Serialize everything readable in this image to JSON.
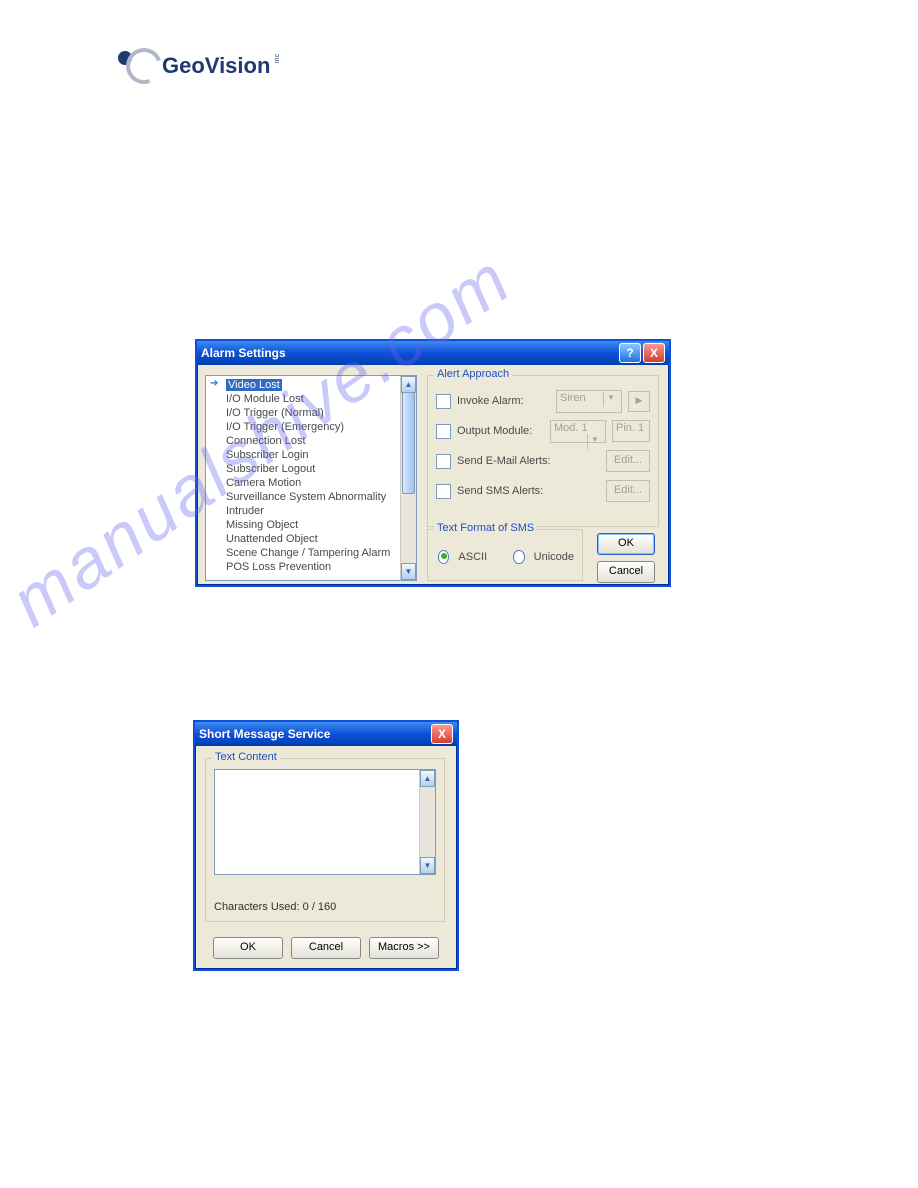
{
  "logo": {
    "geo": "Geo",
    "vision": "Vision",
    "inc": "inc"
  },
  "watermark": "manualshive.com",
  "alarm": {
    "title": "Alarm Settings",
    "help": "?",
    "close": "X",
    "list": [
      "Video Lost",
      "I/O Module Lost",
      "I/O Trigger (Normal)",
      "I/O Trigger (Emergency)",
      "Connection Lost",
      "Subscriber Login",
      "Subscriber Logout",
      "Camera Motion",
      "Surveillance System Abnormality",
      "Intruder",
      "Missing Object",
      "Unattended Object",
      "Scene Change / Tampering Alarm",
      "POS Loss Prevention"
    ],
    "group1": {
      "title": "Alert Approach",
      "invoke": "Invoke Alarm:",
      "siren": "Siren",
      "output": "Output Module:",
      "mod": "Mod. 1",
      "pin": "Pin. 1",
      "email": "Send E-Mail Alerts:",
      "edit": "Edit...",
      "sms": "Send SMS Alerts:"
    },
    "group2": {
      "title": "Text Format of SMS",
      "ascii": "ASCII",
      "unicode": "Unicode"
    },
    "ok": "OK",
    "cancel": "Cancel"
  },
  "sms": {
    "title": "Short Message Service",
    "close": "X",
    "group": "Text Content",
    "chars": "Characters Used:  0 / 160",
    "ok": "OK",
    "cancel": "Cancel",
    "macros": "Macros >>"
  }
}
